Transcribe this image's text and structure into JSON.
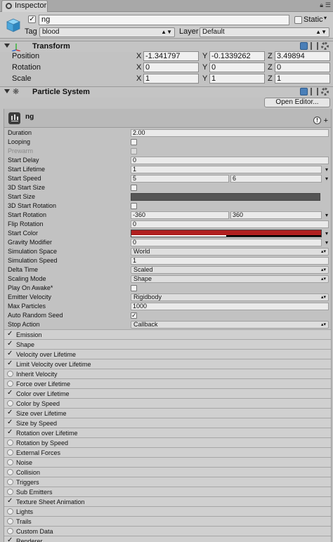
{
  "tab": {
    "title": "Inspector"
  },
  "header": {
    "name": "ng",
    "active": true,
    "static_label": "Static",
    "tag_label": "Tag",
    "tag_value": "blood",
    "layer_label": "Layer",
    "layer_value": "Default"
  },
  "transform": {
    "title": "Transform",
    "rows": [
      {
        "label": "Position",
        "x": "-1.341797",
        "y": "-0.1339262",
        "z": "3.49894"
      },
      {
        "label": "Rotation",
        "x": "0",
        "y": "0",
        "z": "0"
      },
      {
        "label": "Scale",
        "x": "1",
        "y": "1",
        "z": "1"
      }
    ],
    "axes": [
      "X",
      "Y",
      "Z"
    ]
  },
  "particle_system": {
    "title": "Particle System",
    "open_editor": "Open Editor...",
    "module_name": "ng",
    "props": [
      {
        "label": "Duration",
        "value": "2.00"
      },
      {
        "label": "Looping",
        "value": ""
      },
      {
        "label": "Prewarm",
        "value": ""
      },
      {
        "label": "Start Delay",
        "value": "0"
      },
      {
        "label": "Start Lifetime",
        "value": "1"
      },
      {
        "label": "Start Speed",
        "value": "5",
        "value2": "6"
      },
      {
        "label": "3D Start Size",
        "value": ""
      },
      {
        "label": "Start Size",
        "value": ""
      },
      {
        "label": "3D Start Rotation",
        "value": ""
      },
      {
        "label": "Start Rotation",
        "value": "-360",
        "value2": "360"
      },
      {
        "label": "Flip Rotation",
        "value": "0"
      },
      {
        "label": "Start Color",
        "value": ""
      },
      {
        "label": "Gravity Modifier",
        "value": "0"
      },
      {
        "label": "Simulation Space",
        "value": "World"
      },
      {
        "label": "Simulation Speed",
        "value": "1"
      },
      {
        "label": "Delta Time",
        "value": "Scaled"
      },
      {
        "label": "Scaling Mode",
        "value": "Shape"
      },
      {
        "label": "Play On Awake*",
        "value": ""
      },
      {
        "label": "Emitter Velocity",
        "value": "Rigidbody"
      },
      {
        "label": "Max Particles",
        "value": "1000"
      },
      {
        "label": "Auto Random Seed",
        "value": ""
      },
      {
        "label": "Stop Action",
        "value": "Callback"
      }
    ],
    "modules": [
      {
        "label": "Emission",
        "on": true
      },
      {
        "label": "Shape",
        "on": true
      },
      {
        "label": "Velocity over Lifetime",
        "on": true
      },
      {
        "label": "Limit Velocity over Lifetime",
        "on": true
      },
      {
        "label": "Inherit Velocity",
        "on": false
      },
      {
        "label": "Force over Lifetime",
        "on": false
      },
      {
        "label": "Color over Lifetime",
        "on": true
      },
      {
        "label": "Color by Speed",
        "on": false
      },
      {
        "label": "Size over Lifetime",
        "on": true
      },
      {
        "label": "Size by Speed",
        "on": true
      },
      {
        "label": "Rotation over Lifetime",
        "on": true
      },
      {
        "label": "Rotation by Speed",
        "on": false
      },
      {
        "label": "External Forces",
        "on": false
      },
      {
        "label": "Noise",
        "on": false
      },
      {
        "label": "Collision",
        "on": false
      },
      {
        "label": "Triggers",
        "on": false
      },
      {
        "label": "Sub Emitters",
        "on": false
      },
      {
        "label": "Texture Sheet Animation",
        "on": true
      },
      {
        "label": "Lights",
        "on": false
      },
      {
        "label": "Trails",
        "on": false
      },
      {
        "label": "Custom Data",
        "on": false
      },
      {
        "label": "Renderer",
        "on": true
      }
    ]
  },
  "colors": {
    "start_color": "#b02020",
    "start_size_bar": "#555555"
  }
}
